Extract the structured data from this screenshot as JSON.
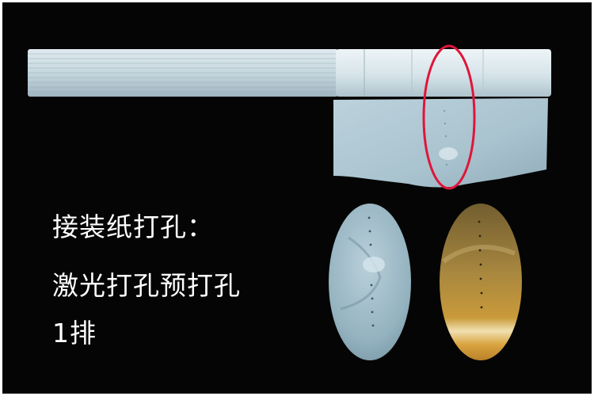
{
  "captions": {
    "title": "接装纸打孔：",
    "method": "激光打孔预打孔",
    "rows": "1排"
  },
  "colors": {
    "background": "#050505",
    "paper": "#cfdfe6",
    "highlight_ring": "#e0153a",
    "gold_foil": "#c99a3a"
  }
}
